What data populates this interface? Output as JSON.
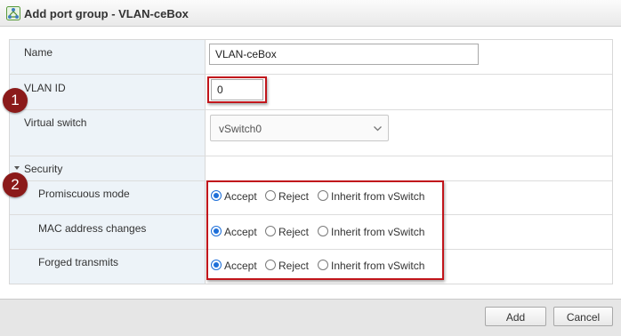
{
  "dialog": {
    "title": "Add port group - VLAN-ceBox",
    "icon": "network-port-group-icon"
  },
  "form": {
    "name": {
      "label": "Name",
      "value": "VLAN-ceBox"
    },
    "vlan_id": {
      "label": "VLAN ID",
      "value": "0"
    },
    "virtual_switch": {
      "label": "Virtual switch",
      "selected": "vSwitch0"
    },
    "security": {
      "label": "Security",
      "expanded": true,
      "options": [
        "Accept",
        "Reject",
        "Inherit from vSwitch"
      ],
      "rows": [
        {
          "label": "Promiscuous mode",
          "selected": "Accept"
        },
        {
          "label": "MAC address changes",
          "selected": "Accept"
        },
        {
          "label": "Forged transmits",
          "selected": "Accept"
        }
      ]
    }
  },
  "annotations": {
    "badge_1": "1",
    "badge_2": "2",
    "highlight_color": "#c1151b",
    "badge_color": "#8b1a1a"
  },
  "footer": {
    "add_label": "Add",
    "cancel_label": "Cancel"
  },
  "colors": {
    "radio_accent": "#1e6fd9",
    "label_column_bg": "#edf3f8"
  }
}
